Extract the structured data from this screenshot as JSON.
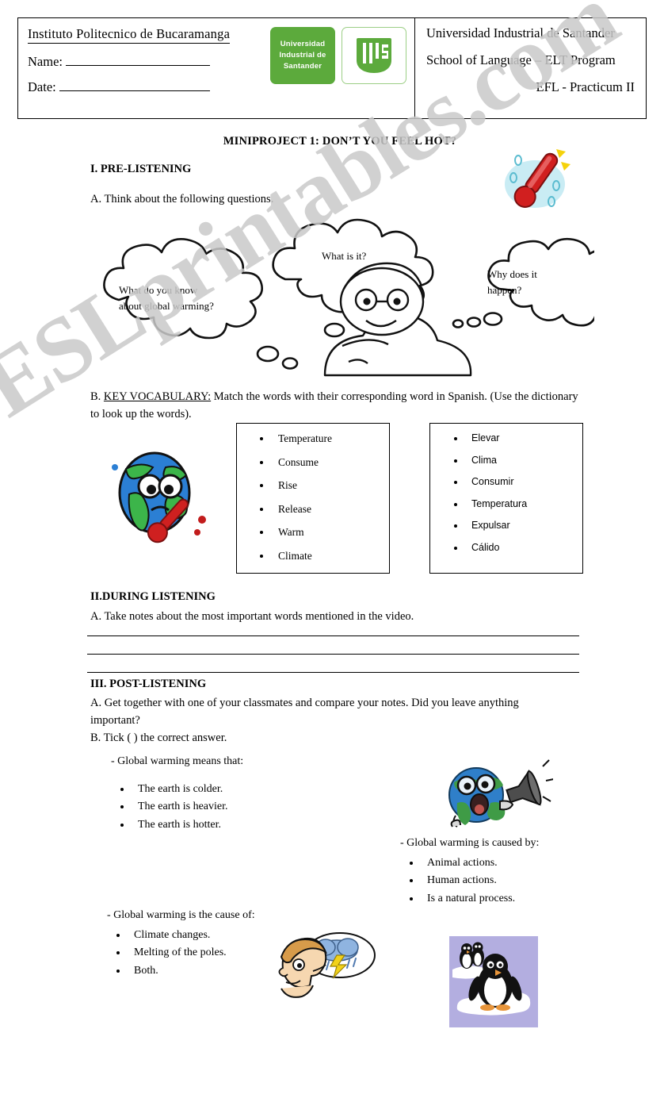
{
  "watermark": {
    "text": "ESLprintables.com"
  },
  "header": {
    "institute": "Instituto Politecnico de Bucaramanga",
    "name_label": "Name:",
    "date_label": "Date:",
    "logo_text": "Universidad Industrial de Santander",
    "logo_line1": "Universidad",
    "logo_line2": "Industrial de",
    "logo_line3": "Santander",
    "logo_mark_text": "UIS",
    "university": "Universidad Industrial  de Santander",
    "school": "School of Language – ELT Program",
    "course": "EFL - Practicum II",
    "brand_color": "#5caa3c"
  },
  "title": "MINIPROJECT 1: DON’T YOU FEEL HOT?",
  "sections": {
    "pre_listening": {
      "heading": "I. PRE-LISTENING",
      "item_a": "A. Think about the following questions.",
      "bubbles": [
        {
          "line1": "What do you know",
          "line2": "about global warming?"
        },
        {
          "line1": "What is it?",
          "line2": ""
        },
        {
          "line1": "Why does it",
          "line2": "happen?"
        }
      ],
      "item_b_prefix": "B. ",
      "item_b_label": "KEY VOCABULARY:",
      "item_b_text": " Match the words with their corresponding word in Spanish. (Use the dictionary to look up the words).",
      "vocab_english": [
        "Temperature",
        "Consume",
        "Rise",
        "Release",
        "Warm",
        "Climate"
      ],
      "vocab_spanish": [
        "Elevar",
        "Clima",
        "Consumir",
        "Temperatura",
        "Expulsar",
        "Cálido"
      ]
    },
    "during_listening": {
      "heading": "II.DURING LISTENING",
      "item_a": "A. Take notes about the most important words mentioned in the video.",
      "note_lines": 3
    },
    "post_listening": {
      "heading": "III. POST-LISTENING",
      "item_a": "A. Get together with one of your classmates and compare your notes. Did you leave anything important?",
      "item_b": "B. Tick ( ) the correct answer.",
      "questions": [
        {
          "prompt": "- Global warming means that:",
          "options": [
            "The earth is colder.",
            "The earth is heavier.",
            "The earth is hotter."
          ]
        },
        {
          "prompt": "- Global warming is caused by:",
          "options": [
            "Animal actions.",
            "Human actions.",
            "Is a natural process."
          ]
        },
        {
          "prompt": "- Global warming is the cause of:",
          "options": [
            "Climate changes.",
            "Melting of the poles.",
            "Both."
          ]
        }
      ]
    }
  },
  "illustrations": {
    "thermometer_hot": "hot-thermometer-icon",
    "thinking_boy": "thinking-boy-illustration",
    "sick_earth": "sick-earth-thermometer-illustration",
    "earth_megaphone": "earth-megaphone-illustration",
    "worried_man_storm": "worried-man-storm-cloud-illustration",
    "penguins_ice": "penguins-on-ice-illustration"
  }
}
